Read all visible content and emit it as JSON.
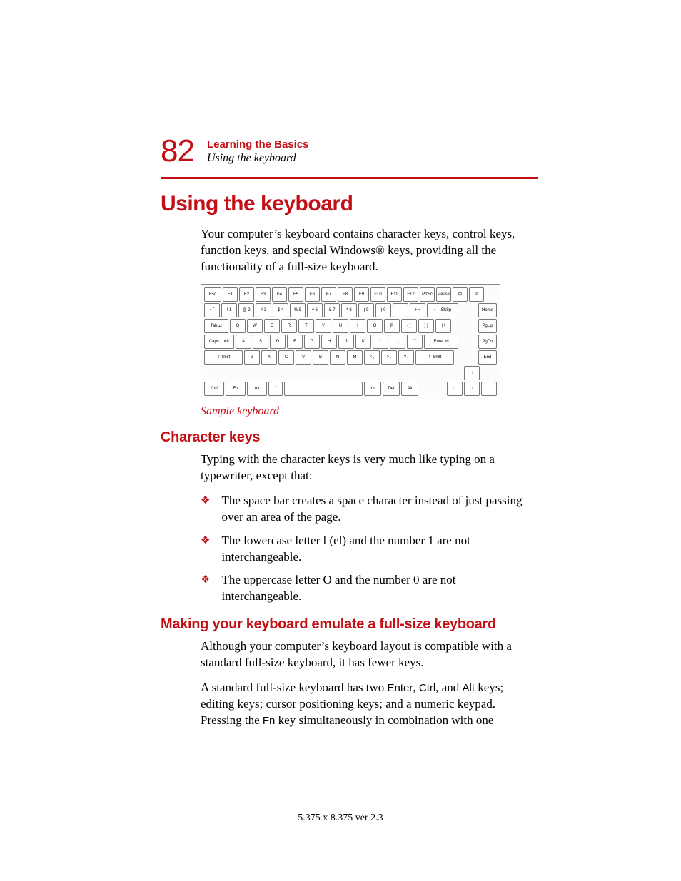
{
  "header": {
    "page_number": "82",
    "chapter": "Learning the Basics",
    "subchapter": "Using the keyboard"
  },
  "section_title": "Using the keyboard",
  "intro": "Your computer’s keyboard contains character keys, control keys, function keys, and special Windows® keys, providing all the functionality of a full-size keyboard.",
  "figure_caption": "Sample keyboard",
  "sub1_title": "Character keys",
  "sub1_intro": "Typing with the character keys is very much like typing on a typewriter, except that:",
  "bullets": [
    "The space bar creates a space character instead of just passing over an area of the page.",
    "The lowercase letter l (el) and the number 1 are not interchangeable.",
    "The uppercase letter O and the number 0 are not interchangeable."
  ],
  "sub2_title": "Making your keyboard emulate a full-size keyboard",
  "sub2_p1": "Although your computer’s keyboard layout is compatible with a standard full-size keyboard, it has fewer keys.",
  "sub2_p2_a": "A standard full-size keyboard has two ",
  "sub2_p2_keys": {
    "enter": "Enter",
    "ctrl": "Ctrl",
    "alt": "Alt",
    "fn": "Fn"
  },
  "sub2_p2_b": " keys; editing keys; cursor positioning keys; and a numeric keypad. Pressing the ",
  "sub2_p2_c": " key simultaneously in combination with one",
  "footer": "5.375 x 8.375 ver 2.3",
  "kbd": {
    "row0": [
      "Esc",
      "F1",
      "F2",
      "F3",
      "F4",
      "F5",
      "F6",
      "F7",
      "F8",
      "F9",
      "F10",
      "F11",
      "F12",
      "PrtSc",
      "Pause",
      "⊞",
      "≡"
    ],
    "row1_left": [
      "~ `",
      "! 1",
      "@ 2",
      "# 3",
      "$ 4",
      "% 5",
      "^ 6",
      "& 7",
      "* 8",
      "( 9",
      ") 0",
      "_ -",
      "+ ="
    ],
    "row1_bksp": "⟵ BkSp",
    "row1_right": "Home",
    "row2_tab": "Tab ⇄",
    "row2_keys": [
      "Q",
      "W",
      "E",
      "R",
      "T",
      "Y",
      "U",
      "I",
      "O",
      "P",
      "{ [",
      "} ]",
      "| \\"
    ],
    "row2_right": "PgUp",
    "row3_caps": "Caps Lock",
    "row3_keys": [
      "A",
      "S",
      "D",
      "F",
      "G",
      "H",
      "J",
      "K",
      "L",
      ": ;",
      "\" '"
    ],
    "row3_enter": "Enter ⏎",
    "row3_right": "PgDn",
    "row4_lshift": "⇧ Shift",
    "row4_keys": [
      "Z",
      "X",
      "C",
      "V",
      "B",
      "N",
      "M",
      "< ,",
      "> .",
      "? /"
    ],
    "row4_rshift": "⇧ Shift",
    "row4_right": "End",
    "row5": [
      "Ctrl",
      "Fn",
      "Alt",
      "`",
      "",
      "Ins",
      "Del",
      "Alt"
    ],
    "arrows": {
      "up": "↑",
      "left": "←",
      "down": "↓",
      "right": "→"
    }
  }
}
